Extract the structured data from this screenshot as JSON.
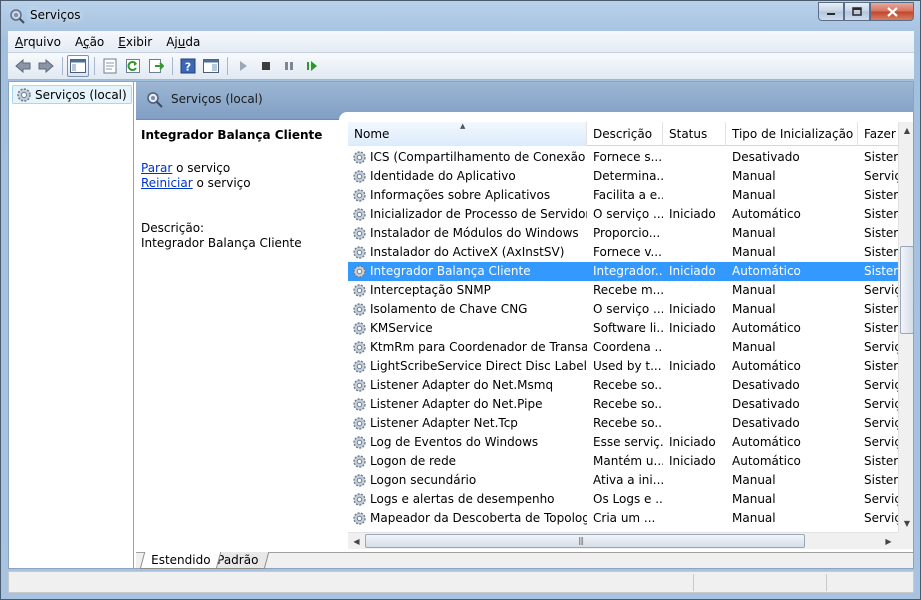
{
  "window": {
    "title": "Serviços",
    "title_icon": "services-gear-magnifier-icon"
  },
  "caption_buttons": [
    "minimize-icon",
    "maximize-icon",
    "close-icon"
  ],
  "menu": [
    {
      "accel": "A",
      "rest": "rquivo"
    },
    {
      "accel": "",
      "pre": "A",
      "accel2": "ç",
      "rest": "ão"
    },
    {
      "accel": "E",
      "rest": "xibir"
    },
    {
      "accel": "",
      "pre": "Aj",
      "accel2": "u",
      "rest": "da"
    }
  ],
  "toolbar": {
    "buttons": [
      "back-arrow-icon",
      "forward-arrow-icon",
      "show-hide-console-tree-icon",
      "properties-icon",
      "refresh-icon",
      "export-list-icon",
      "help-icon",
      "show-hide-action-pane-icon",
      "start-service-icon",
      "stop-service-icon",
      "pause-service-icon",
      "restart-service-icon"
    ]
  },
  "tree": {
    "root_label": "Serviços (local)"
  },
  "content": {
    "header_title": "Serviços (local)",
    "detail": {
      "service_name": "Integrador Balança Cliente",
      "action1_link": "Parar",
      "action1_rest": " o serviço",
      "action2_link": "Reiniciar",
      "action2_rest": " o serviço",
      "description_label": "Descrição:",
      "description_text": "Integrador Balança Cliente"
    },
    "columns": [
      "Nome",
      "Descrição",
      "Status",
      "Tipo de Inicialização",
      "Fazer"
    ],
    "rows": [
      {
        "name": "ICS (Compartilhamento de Conexão co...",
        "desc": "Fornece s...",
        "status": "",
        "startup": "Desativado",
        "logon": "Sistem"
      },
      {
        "name": "Identidade do Aplicativo",
        "desc": "Determina...",
        "status": "",
        "startup": "Manual",
        "logon": "Serviç"
      },
      {
        "name": "Informações sobre Aplicativos",
        "desc": "Facilita a e...",
        "status": "",
        "startup": "Manual",
        "logon": "Sistem"
      },
      {
        "name": "Inicializador de Processo de Servidor D...",
        "desc": "O serviço ...",
        "status": "Iniciado",
        "startup": "Automático",
        "logon": "Sistem"
      },
      {
        "name": "Instalador de Módulos do Windows",
        "desc": "Proporcio...",
        "status": "",
        "startup": "Manual",
        "logon": "Sistem"
      },
      {
        "name": "Instalador do ActiveX (AxInstSV)",
        "desc": "Fornece v...",
        "status": "",
        "startup": "Manual",
        "logon": "Sistem"
      },
      {
        "name": "Integrador Balança Cliente",
        "desc": "Integrador...",
        "status": "Iniciado",
        "startup": "Automático",
        "logon": "Sistem",
        "selected": true
      },
      {
        "name": "Interceptação SNMP",
        "desc": "Recebe m...",
        "status": "",
        "startup": "Manual",
        "logon": "Serviç"
      },
      {
        "name": "Isolamento de Chave CNG",
        "desc": "O serviço ...",
        "status": "Iniciado",
        "startup": "Manual",
        "logon": "Sistem"
      },
      {
        "name": "KMService",
        "desc": "Software li...",
        "status": "Iniciado",
        "startup": "Automático",
        "logon": "Sistem"
      },
      {
        "name": "KtmRm para Coordenador de Transaçõ...",
        "desc": "Coordena ...",
        "status": "",
        "startup": "Manual",
        "logon": "Serviç"
      },
      {
        "name": "LightScribeService Direct Disc Labeling ...",
        "desc": "Used by t...",
        "status": "Iniciado",
        "startup": "Automático",
        "logon": "Sistem"
      },
      {
        "name": "Listener Adapter do Net.Msmq",
        "desc": "Recebe so...",
        "status": "",
        "startup": "Desativado",
        "logon": "Serviç"
      },
      {
        "name": "Listener Adapter do Net.Pipe",
        "desc": "Recebe so...",
        "status": "",
        "startup": "Desativado",
        "logon": "Serviç"
      },
      {
        "name": "Listener Adapter Net.Tcp",
        "desc": "Recebe so...",
        "status": "",
        "startup": "Desativado",
        "logon": "Serviç"
      },
      {
        "name": "Log de Eventos do Windows",
        "desc": "Esse serviç...",
        "status": "Iniciado",
        "startup": "Automático",
        "logon": "Serviç"
      },
      {
        "name": "Logon de rede",
        "desc": "Mantém u...",
        "status": "Iniciado",
        "startup": "Automático",
        "logon": "Sistem"
      },
      {
        "name": "Logon secundário",
        "desc": "Ativa a ini...",
        "status": "",
        "startup": "Manual",
        "logon": "Sistem"
      },
      {
        "name": "Logs e alertas de desempenho",
        "desc": "Os Logs e ...",
        "status": "",
        "startup": "Manual",
        "logon": "Serviç"
      },
      {
        "name": "Mapeador da Descoberta de Topologia...",
        "desc": "Cria um ...",
        "status": "",
        "startup": "Manual",
        "logon": "Serviç"
      }
    ],
    "tabs": [
      "Estendido",
      "Padrão"
    ],
    "active_tab": "Estendido",
    "vertical_scroll_percent": 33
  },
  "colors": {
    "selection": "#3399ff",
    "link": "#0033cc",
    "header_band": "#9cb6d3"
  }
}
